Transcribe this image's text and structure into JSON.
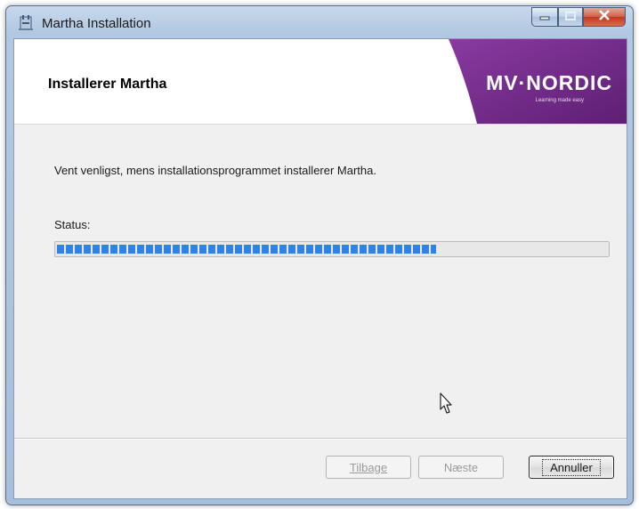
{
  "window": {
    "title": "Martha Installation"
  },
  "banner": {
    "title": "Installerer Martha",
    "logo_text": "MV·NORDIC",
    "logo_tagline": "Learning made easy"
  },
  "body": {
    "message": "Vent venligst, mens installationsprogrammet installerer Martha.",
    "status_label": "Status:",
    "progress_fraction": 0.69
  },
  "buttons": {
    "back_label": "Tilbage",
    "next_label": "Næste",
    "cancel_label": "Annuller"
  },
  "colors": {
    "progress": "#2f82e6",
    "logo_purple": "#7b2d8e"
  }
}
